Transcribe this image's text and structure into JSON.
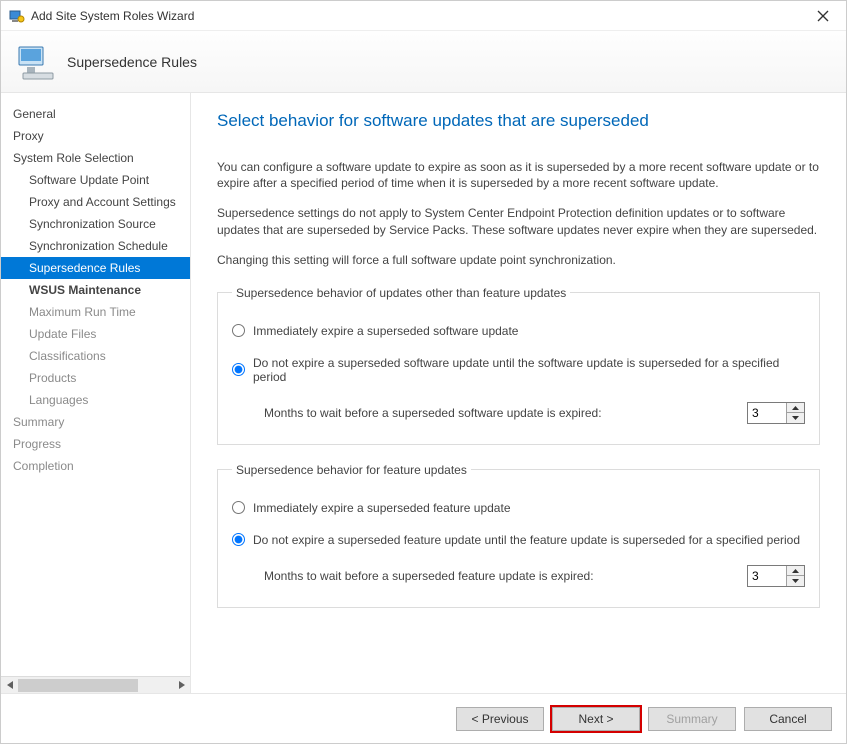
{
  "window": {
    "title": "Add Site System Roles Wizard"
  },
  "header": {
    "title": "Supersedence Rules"
  },
  "sidebar": {
    "steps": [
      {
        "label": "General",
        "indent": false,
        "state": "done"
      },
      {
        "label": "Proxy",
        "indent": false,
        "state": "done"
      },
      {
        "label": "System Role Selection",
        "indent": false,
        "state": "done"
      },
      {
        "label": "Software Update Point",
        "indent": true,
        "state": "done"
      },
      {
        "label": "Proxy and Account Settings",
        "indent": true,
        "state": "done"
      },
      {
        "label": "Synchronization Source",
        "indent": true,
        "state": "done"
      },
      {
        "label": "Synchronization Schedule",
        "indent": true,
        "state": "done"
      },
      {
        "label": "Supersedence Rules",
        "indent": true,
        "state": "selected"
      },
      {
        "label": "WSUS Maintenance",
        "indent": true,
        "state": "bold"
      },
      {
        "label": "Maximum Run Time",
        "indent": true,
        "state": "future"
      },
      {
        "label": "Update Files",
        "indent": true,
        "state": "future"
      },
      {
        "label": "Classifications",
        "indent": true,
        "state": "future"
      },
      {
        "label": "Products",
        "indent": true,
        "state": "future"
      },
      {
        "label": "Languages",
        "indent": true,
        "state": "future"
      },
      {
        "label": "Summary",
        "indent": false,
        "state": "future"
      },
      {
        "label": "Progress",
        "indent": false,
        "state": "future"
      },
      {
        "label": "Completion",
        "indent": false,
        "state": "future"
      }
    ]
  },
  "page": {
    "title": "Select behavior for software updates that are superseded",
    "para1": "You can configure a software update to expire as soon as it is superseded by a more recent software update or to expire after a specified period of time when it is superseded by a more recent software update.",
    "para2": "Supersedence settings do not apply to System Center Endpoint Protection definition updates or to software updates that are superseded by Service Packs. These software updates never expire when they are superseded.",
    "para3": "Changing this setting will force a full software update point synchronization."
  },
  "group1": {
    "legend": "Supersedence behavior of updates other than feature updates",
    "opt1": "Immediately expire a superseded software update",
    "opt2": "Do not expire a superseded software update until the software update is superseded for a specified period",
    "months_label": "Months to wait before a superseded software update is expired:",
    "months_value": "3",
    "selected": "opt2"
  },
  "group2": {
    "legend": "Supersedence behavior for feature updates",
    "opt1": "Immediately expire a superseded feature update",
    "opt2": "Do not expire a superseded feature update until the feature update is superseded for a specified period",
    "months_label": "Months to wait before a superseded feature update is expired:",
    "months_value": "3",
    "selected": "opt2"
  },
  "footer": {
    "previous": "< Previous",
    "next": "Next >",
    "summary": "Summary",
    "cancel": "Cancel"
  }
}
